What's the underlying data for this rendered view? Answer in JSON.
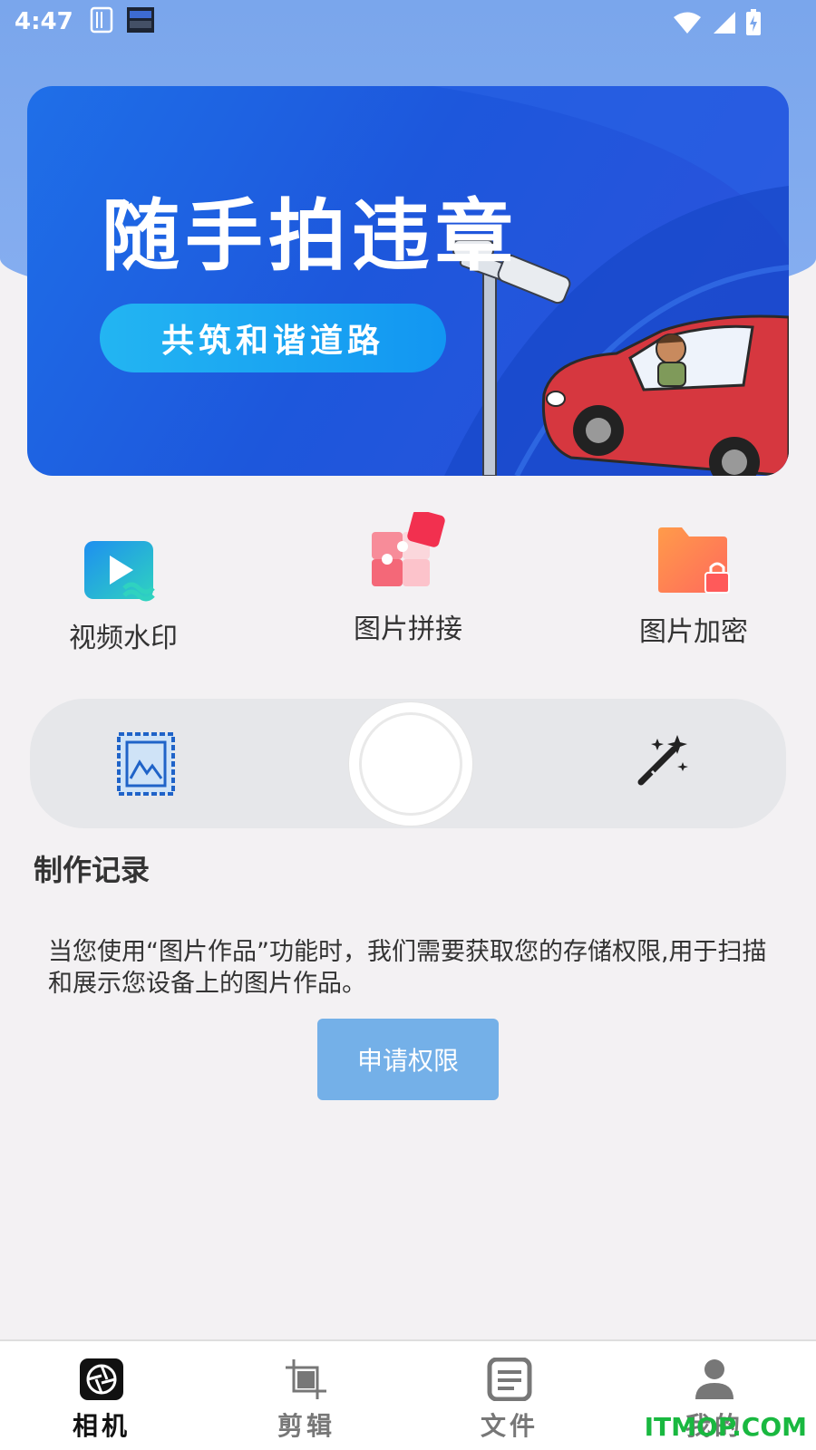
{
  "status_bar": {
    "time": "4:47"
  },
  "banner": {
    "title": "随手拍违章",
    "slogan": "共筑和谐道路"
  },
  "features": [
    {
      "label": "视频水印",
      "icon": "video-watermark-icon"
    },
    {
      "label": "图片拼接",
      "icon": "puzzle-icon"
    },
    {
      "label": "图片加密",
      "icon": "locked-folder-icon"
    }
  ],
  "camera_panel": {
    "left_icon": "stamp-image-icon",
    "center": "shutter-button",
    "right_icon": "magic-wand-icon"
  },
  "records": {
    "title": "制作记录",
    "permission_text": "当您使用“图片作品”功能时，我们需要获取您的存储权限,用于扫描和展示您设备上的图片作品。",
    "permission_button": "申请权限"
  },
  "bottom_nav": [
    {
      "label": "相机",
      "icon": "camera-aperture-icon",
      "active": true
    },
    {
      "label": "剪辑",
      "icon": "crop-icon",
      "active": false
    },
    {
      "label": "文件",
      "icon": "document-icon",
      "active": false
    },
    {
      "label": "我的",
      "icon": "user-icon",
      "active": false
    }
  ],
  "watermark": "ITMOP.COM",
  "colors": {
    "top_background": "#7aa6ec",
    "banner_blue": "#1d57dc",
    "slogan_pill": "#1a9ff2",
    "permission_button": "#74b0e8",
    "watermark": "#19b840"
  }
}
